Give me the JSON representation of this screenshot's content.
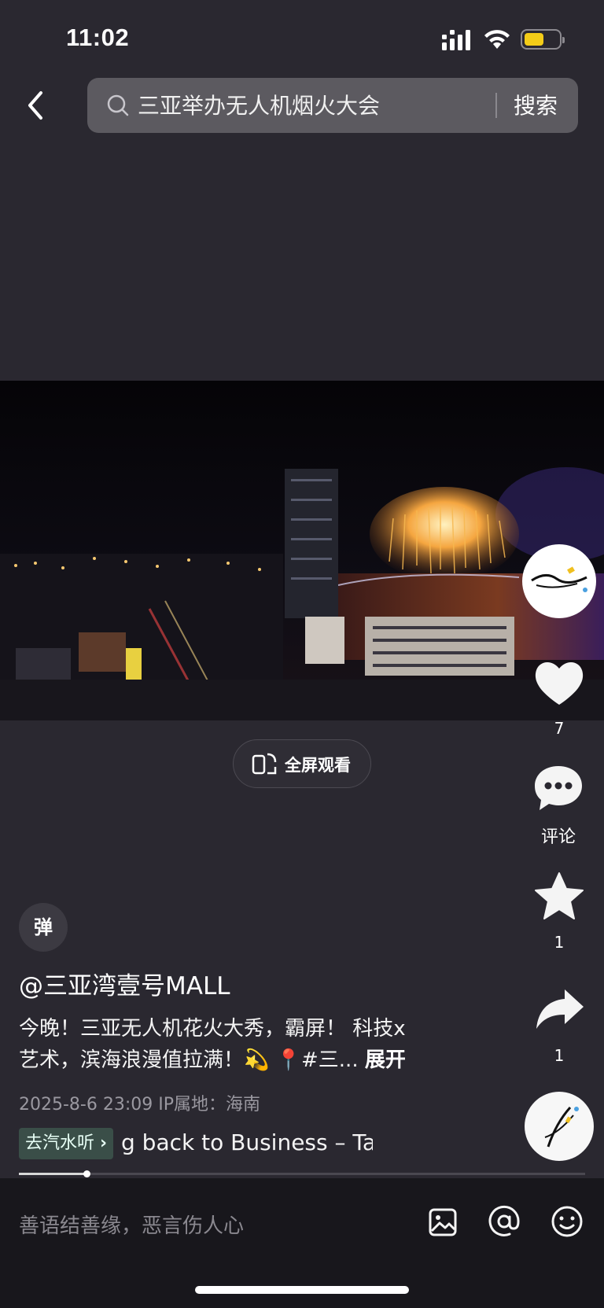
{
  "status_bar": {
    "time": "11:02",
    "battery_color": "#f3cc18"
  },
  "search": {
    "query": "三亚举办无人机烟火大会",
    "button_label": "搜索"
  },
  "video": {
    "fullscreen_label": "全屏观看"
  },
  "actions": {
    "like_count": "7",
    "comment_label": "评论",
    "favorite_count": "1",
    "share_count": "1"
  },
  "post": {
    "danmu_label": "弹",
    "author": "@三亚湾壹号MALL",
    "description_line1": "今晚！三亚无人机花火大秀，霸屏！ 科技x",
    "description_line2": "艺术，滨海浪漫值拉满！💫 📍#三...",
    "expand_label": "展开",
    "meta": "2025-8-6 23:09   IP属地：海南",
    "music_tag": "去汽水听",
    "music_title": "g back to Business – Ta",
    "progress": 0.12
  },
  "comment_bar": {
    "placeholder": "善语结善缘，恶言伤人心"
  },
  "icons": [
    "back-icon",
    "search-icon",
    "heart-icon",
    "comment-icon",
    "star-icon",
    "share-icon",
    "image-icon",
    "at-icon",
    "emoji-icon"
  ]
}
